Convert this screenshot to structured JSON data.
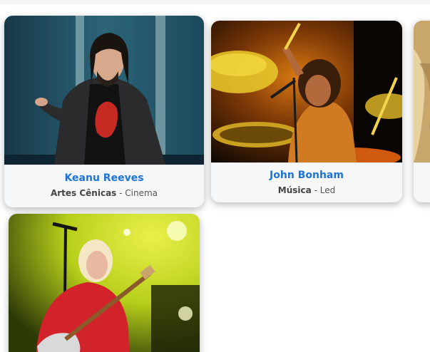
{
  "cards": [
    {
      "name": "Keanu Reeves",
      "category": "Artes Cênicas",
      "separator": " - ",
      "subcategory": "Cinema"
    },
    {
      "name": "John Bonham",
      "category": "Música",
      "separator": " - ",
      "subcategory": "Led"
    },
    {
      "name": "",
      "category": "",
      "separator": "",
      "subcategory": ""
    },
    {
      "name": "",
      "category": "",
      "separator": "",
      "subcategory": ""
    }
  ],
  "colors": {
    "name_link": "#1d73d8",
    "card_footer": "#f6f7f9",
    "page_background": "#ffffff"
  }
}
